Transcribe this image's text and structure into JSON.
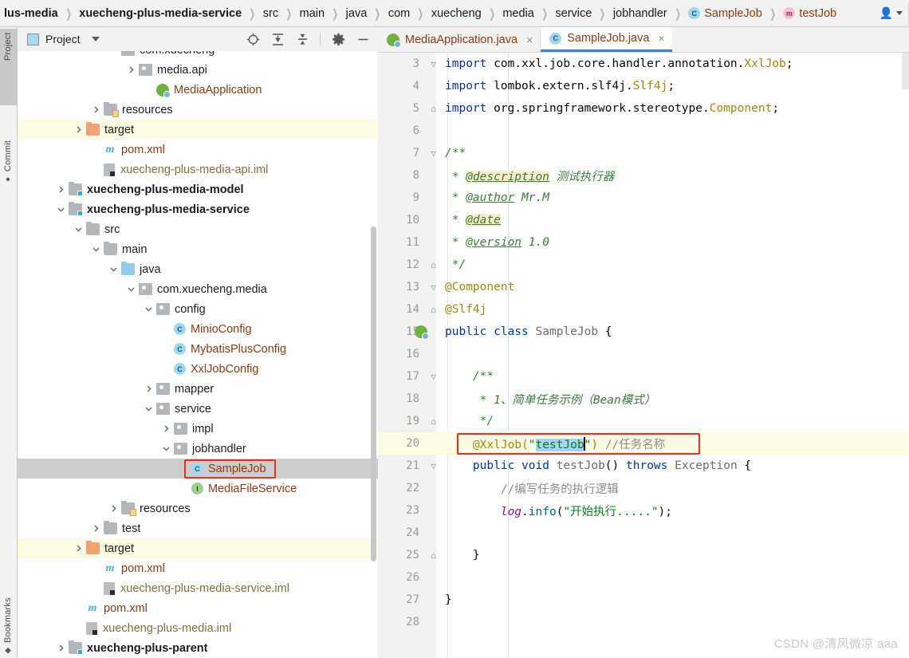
{
  "breadcrumb": {
    "items": [
      {
        "label": "lus-media",
        "bold": true,
        "icon": null
      },
      {
        "label": "xuecheng-plus-media-service",
        "bold": true,
        "icon": null
      },
      {
        "label": "src",
        "bold": false,
        "icon": null
      },
      {
        "label": "main",
        "bold": false,
        "icon": null
      },
      {
        "label": "java",
        "bold": false,
        "icon": null
      },
      {
        "label": "com",
        "bold": false,
        "icon": null
      },
      {
        "label": "xuecheng",
        "bold": false,
        "icon": null
      },
      {
        "label": "media",
        "bold": false,
        "icon": null
      },
      {
        "label": "service",
        "bold": false,
        "icon": null
      },
      {
        "label": "jobhandler",
        "bold": false,
        "icon": null
      },
      {
        "label": "SampleJob",
        "bold": false,
        "icon": "class-icon",
        "icon_letter": "C"
      },
      {
        "label": "testJob",
        "bold": false,
        "icon": "method-icon",
        "icon_letter": "m"
      }
    ],
    "separator": "❯",
    "user_icon": "user-icon"
  },
  "toolstrip": {
    "project_label": "Project",
    "commit_label": "Commit",
    "bookmarks_label": "Bookmarks"
  },
  "project_panel": {
    "title": "Project",
    "tools": [
      "locate-icon",
      "expand-all-icon",
      "collapse-all-icon",
      "settings-icon",
      "minimize-icon"
    ],
    "tree": [
      {
        "indent": 5,
        "twisty": "",
        "icon": "package-folder",
        "name": "com.xuecheng",
        "style": "dark",
        "row": "normal",
        "clipped": true
      },
      {
        "indent": 6,
        "twisty": "right",
        "icon": "package-folder",
        "name": "media.api",
        "style": "dark",
        "row": "normal"
      },
      {
        "indent": 7,
        "twisty": "",
        "icon": "spring-class",
        "name": "MediaApplication",
        "style": "brown",
        "row": "normal"
      },
      {
        "indent": 4,
        "twisty": "right",
        "icon": "resources-folder",
        "name": "resources",
        "style": "dark",
        "row": "normal"
      },
      {
        "indent": 3,
        "twisty": "right",
        "icon": "orange-folder",
        "name": "target",
        "style": "dark",
        "row": "target"
      },
      {
        "indent": 4,
        "twisty": "",
        "icon": "maven-m",
        "name": "pom.xml",
        "style": "brown",
        "row": "normal"
      },
      {
        "indent": 4,
        "twisty": "",
        "icon": "iml-file",
        "name": "xuecheng-plus-media-api.iml",
        "style": "olive",
        "row": "normal"
      },
      {
        "indent": 2,
        "twisty": "right",
        "icon": "module-folder",
        "name": "xuecheng-plus-media-model",
        "style": "bold",
        "row": "normal"
      },
      {
        "indent": 2,
        "twisty": "down",
        "icon": "module-folder",
        "name": "xuecheng-plus-media-service",
        "style": "bold",
        "row": "normal"
      },
      {
        "indent": 3,
        "twisty": "down",
        "icon": "grey-folder",
        "name": "src",
        "style": "dark",
        "row": "normal"
      },
      {
        "indent": 4,
        "twisty": "down",
        "icon": "grey-folder",
        "name": "main",
        "style": "dark",
        "row": "normal"
      },
      {
        "indent": 5,
        "twisty": "down",
        "icon": "blue-folder",
        "name": "java",
        "style": "dark",
        "row": "normal"
      },
      {
        "indent": 6,
        "twisty": "down",
        "icon": "package-folder",
        "name": "com.xuecheng.media",
        "style": "dark",
        "row": "normal"
      },
      {
        "indent": 7,
        "twisty": "down",
        "icon": "package-folder",
        "name": "config",
        "style": "dark",
        "row": "normal"
      },
      {
        "indent": 8,
        "twisty": "",
        "icon": "class-icon",
        "name": "MinioConfig",
        "style": "brown",
        "row": "normal"
      },
      {
        "indent": 8,
        "twisty": "",
        "icon": "class-icon",
        "name": "MybatisPlusConfig",
        "style": "brown",
        "row": "normal"
      },
      {
        "indent": 8,
        "twisty": "",
        "icon": "class-icon",
        "name": "XxlJobConfig",
        "style": "brown",
        "row": "normal"
      },
      {
        "indent": 7,
        "twisty": "right",
        "icon": "package-folder",
        "name": "mapper",
        "style": "dark",
        "row": "normal"
      },
      {
        "indent": 7,
        "twisty": "down",
        "icon": "package-folder",
        "name": "service",
        "style": "dark",
        "row": "normal"
      },
      {
        "indent": 8,
        "twisty": "right",
        "icon": "package-folder",
        "name": "impl",
        "style": "dark",
        "row": "normal"
      },
      {
        "indent": 8,
        "twisty": "down",
        "icon": "package-folder",
        "name": "jobhandler",
        "style": "dark",
        "row": "normal"
      },
      {
        "indent": 9,
        "twisty": "",
        "icon": "class-icon",
        "name": "SampleJob",
        "style": "brown",
        "row": "selected",
        "boxed": true
      },
      {
        "indent": 9,
        "twisty": "",
        "icon": "interface-icon",
        "name": "MediaFileService",
        "style": "brown",
        "row": "normal"
      },
      {
        "indent": 5,
        "twisty": "right",
        "icon": "resources-folder",
        "name": "resources",
        "style": "dark",
        "row": "normal"
      },
      {
        "indent": 4,
        "twisty": "right",
        "icon": "grey-folder",
        "name": "test",
        "style": "dark",
        "row": "normal"
      },
      {
        "indent": 3,
        "twisty": "right",
        "icon": "orange-folder",
        "name": "target",
        "style": "dark",
        "row": "target"
      },
      {
        "indent": 4,
        "twisty": "",
        "icon": "maven-m",
        "name": "pom.xml",
        "style": "brown",
        "row": "normal"
      },
      {
        "indent": 4,
        "twisty": "",
        "icon": "iml-file",
        "name": "xuecheng-plus-media-service.iml",
        "style": "olive",
        "row": "normal"
      },
      {
        "indent": 3,
        "twisty": "",
        "icon": "maven-m",
        "name": "pom.xml",
        "style": "brown",
        "row": "normal"
      },
      {
        "indent": 3,
        "twisty": "",
        "icon": "iml-file",
        "name": "xuecheng-plus-media.iml",
        "style": "olive",
        "row": "normal"
      },
      {
        "indent": 2,
        "twisty": "right",
        "icon": "module-folder",
        "name": "xuecheng-plus-parent",
        "style": "bold",
        "row": "normal"
      }
    ]
  },
  "editor": {
    "tabs": [
      {
        "label": "MediaApplication.java",
        "icon": "spring-class-icon",
        "active": false,
        "close": "×"
      },
      {
        "label": "SampleJob.java",
        "icon": "class-icon",
        "active": true,
        "close": "×"
      }
    ],
    "first_line_number": 3,
    "lines": [
      {
        "n": 3,
        "fold": "▽",
        "highlight": false,
        "tokens": [
          {
            "t": "import ",
            "c": "k"
          },
          {
            "t": "com.xxl.job.core.handler.annotation.",
            "c": "plain"
          },
          {
            "t": "XxlJob",
            "c": "typ"
          },
          {
            "t": ";",
            "c": "plain"
          }
        ]
      },
      {
        "n": 4,
        "fold": "",
        "highlight": false,
        "tokens": [
          {
            "t": "import ",
            "c": "k"
          },
          {
            "t": "lombok.extern.slf4j.",
            "c": "plain"
          },
          {
            "t": "Slf4j",
            "c": "typ"
          },
          {
            "t": ";",
            "c": "plain"
          }
        ]
      },
      {
        "n": 5,
        "fold": "⌂",
        "highlight": false,
        "tokens": [
          {
            "t": "import ",
            "c": "k"
          },
          {
            "t": "org.springframework.stereotype.",
            "c": "plain"
          },
          {
            "t": "Component",
            "c": "typ"
          },
          {
            "t": ";",
            "c": "plain"
          }
        ]
      },
      {
        "n": 6,
        "fold": "",
        "highlight": false,
        "tokens": []
      },
      {
        "n": 7,
        "fold": "▽",
        "highlight": false,
        "tokens": [
          {
            "t": "/**",
            "c": "doc"
          }
        ]
      },
      {
        "n": 8,
        "fold": "",
        "highlight": false,
        "tokens": [
          {
            "t": " * ",
            "c": "doc"
          },
          {
            "t": "@description",
            "c": "docTag"
          },
          {
            "t": " 测试执行器",
            "c": "doc"
          }
        ]
      },
      {
        "n": 9,
        "fold": "",
        "highlight": false,
        "tokens": [
          {
            "t": " * ",
            "c": "doc"
          },
          {
            "t": "@author",
            "c": "docTagP"
          },
          {
            "t": " Mr.M",
            "c": "doc"
          }
        ]
      },
      {
        "n": 10,
        "fold": "",
        "highlight": false,
        "tokens": [
          {
            "t": " * ",
            "c": "doc"
          },
          {
            "t": "@date",
            "c": "docTag"
          }
        ]
      },
      {
        "n": 11,
        "fold": "",
        "highlight": false,
        "tokens": [
          {
            "t": " * ",
            "c": "doc"
          },
          {
            "t": "@version",
            "c": "docTagP"
          },
          {
            "t": " 1.0",
            "c": "doc"
          }
        ]
      },
      {
        "n": 12,
        "fold": "⌂",
        "highlight": false,
        "tokens": [
          {
            "t": " */",
            "c": "doc"
          }
        ]
      },
      {
        "n": 13,
        "fold": "▽",
        "highlight": false,
        "tokens": [
          {
            "t": "@Component",
            "c": "ann"
          }
        ]
      },
      {
        "n": 14,
        "fold": "⌂",
        "highlight": false,
        "tokens": [
          {
            "t": "@Slf4j",
            "c": "ann"
          }
        ]
      },
      {
        "n": 15,
        "fold": "",
        "highlight": false,
        "gutter_icon": "spring-run-icon",
        "tokens": [
          {
            "t": "public class ",
            "c": "k"
          },
          {
            "t": "SampleJob",
            "c": "cls-t"
          },
          {
            "t": " {",
            "c": "plain"
          }
        ]
      },
      {
        "n": 16,
        "fold": "",
        "highlight": false,
        "tokens": []
      },
      {
        "n": 17,
        "fold": "▽",
        "highlight": false,
        "tokens": [
          {
            "t": "    /**",
            "c": "doc"
          }
        ]
      },
      {
        "n": 18,
        "fold": "",
        "highlight": false,
        "tokens": [
          {
            "t": "     * 1、简单任务示例（Bean模式）",
            "c": "doc"
          }
        ]
      },
      {
        "n": 19,
        "fold": "⌂",
        "highlight": false,
        "tokens": [
          {
            "t": "     */",
            "c": "doc"
          }
        ]
      },
      {
        "n": 20,
        "fold": "",
        "highlight": true,
        "boxed": true,
        "tokens": [
          {
            "t": "    @XxlJob(",
            "c": "ann"
          },
          {
            "t": "\"",
            "c": "str"
          },
          {
            "t": "testJob",
            "c": "str sel"
          },
          {
            "t": "\"",
            "c": "str"
          },
          {
            "t": ")",
            "c": "ann"
          },
          {
            "t": " ",
            "c": "plain"
          },
          {
            "t": "//任务名称",
            "c": "cmt"
          }
        ]
      },
      {
        "n": 21,
        "fold": "▽",
        "highlight": false,
        "tokens": [
          {
            "t": "    public void ",
            "c": "k"
          },
          {
            "t": "testJob",
            "c": "cls-t"
          },
          {
            "t": "() ",
            "c": "plain"
          },
          {
            "t": "throws ",
            "c": "k"
          },
          {
            "t": "Exception",
            "c": "cls-t"
          },
          {
            "t": " {",
            "c": "plain"
          }
        ]
      },
      {
        "n": 22,
        "fold": "",
        "highlight": false,
        "tokens": [
          {
            "t": "        //编写任务的执行逻辑",
            "c": "cmt"
          }
        ]
      },
      {
        "n": 23,
        "fold": "",
        "highlight": false,
        "tokens": [
          {
            "t": "        ",
            "c": "plain"
          },
          {
            "t": "log",
            "c": "fld"
          },
          {
            "t": ".",
            "c": "plain"
          },
          {
            "t": "info",
            "c": "mth"
          },
          {
            "t": "(",
            "c": "plain"
          },
          {
            "t": "\"开始执行.....\"",
            "c": "str"
          },
          {
            "t": ");",
            "c": "plain"
          }
        ]
      },
      {
        "n": 24,
        "fold": "",
        "highlight": false,
        "tokens": []
      },
      {
        "n": 25,
        "fold": "⌂",
        "highlight": false,
        "tokens": [
          {
            "t": "    }",
            "c": "plain"
          }
        ]
      },
      {
        "n": 26,
        "fold": "",
        "highlight": false,
        "tokens": []
      },
      {
        "n": 27,
        "fold": "",
        "highlight": false,
        "tokens": [
          {
            "t": "}",
            "c": "plain"
          }
        ]
      },
      {
        "n": 28,
        "fold": "",
        "highlight": false,
        "tokens": []
      }
    ]
  },
  "watermark": "CSDN @清风微凉 aaa",
  "colors": {
    "accent_blue": "#3d82c6",
    "red_highlight": "#ef2a1f",
    "highlight_row": "#fcfbe3",
    "selection_blue": "#a6d2fa",
    "selected_row": "#cdcdcd"
  }
}
